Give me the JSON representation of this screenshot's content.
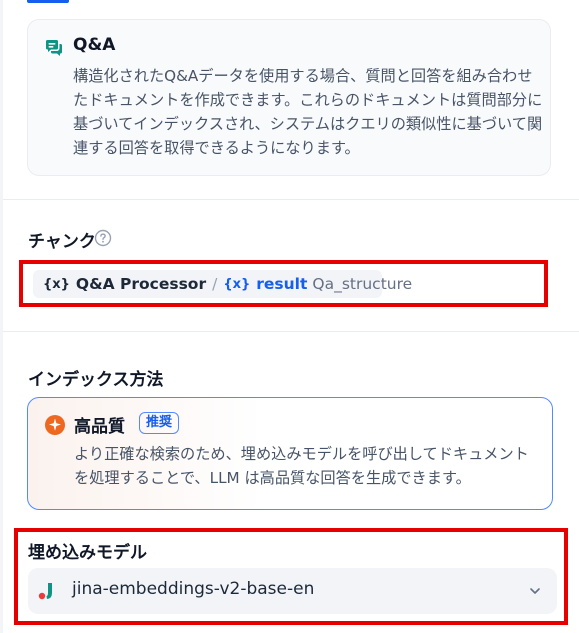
{
  "qa": {
    "title": "Q&A",
    "description": "構造化されたQ&Aデータを使用する場合、質問と回答を組み合わせたドキュメントを作成できます。これらのドキュメントは質問部分に基づいてインデックスされ、システムはクエリの類似性に基づいて関連する回答を取得できるようになります。"
  },
  "chunk": {
    "label": "チャンク",
    "variable": {
      "brace": "{x}",
      "node": "Q&A Processor",
      "separator": "/",
      "field": "result",
      "type": "Qa_structure"
    }
  },
  "index_method": {
    "label": "インデックス方法",
    "option": {
      "title": "高品質",
      "badge": "推奨",
      "description": "より正確な検索のため、埋め込みモデルを呼び出してドキュメントを処理することで、LLM は高品質な回答を生成できます。"
    }
  },
  "embedding": {
    "label": "埋め込みモデル",
    "selected_model": "jina-embeddings-v2-base-en"
  },
  "colors": {
    "accent": "#155eef",
    "highlight": "#e60000",
    "qa_icon": "#0e9384",
    "hq_icon": "#ef6820"
  }
}
